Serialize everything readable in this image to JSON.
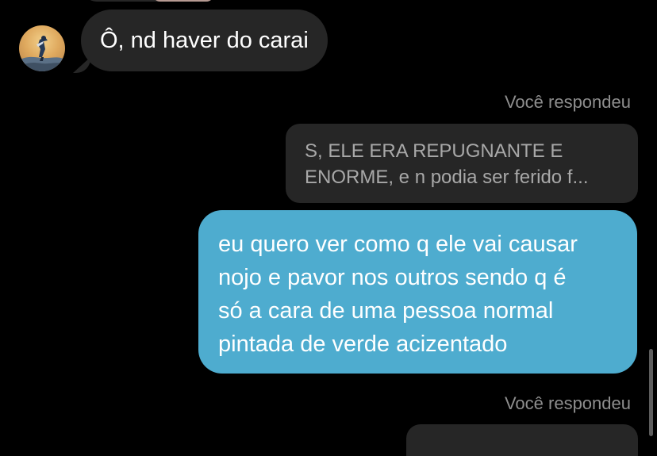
{
  "conversation": {
    "incoming": {
      "text": "Ô, nd haver do carai",
      "avatar_icon": "user-avatar-icon"
    },
    "reply_labels": [
      "Você respondeu",
      "Você respondeu"
    ],
    "quoted": {
      "lines": [
        "S, ELE ERA REPUGNANTE E",
        "ENORME, e n podia ser ferido f..."
      ]
    },
    "outgoing": {
      "lines": [
        "eu quero ver como q ele vai causar",
        "nojo e pavor nos outros sendo q é",
        "só a cara de uma pessoa normal",
        "pintada de verde acizentado"
      ]
    }
  },
  "colors": {
    "background": "#000000",
    "incoming_bubble": "#262626",
    "outgoing_bubble": "#4eaccf",
    "muted_text": "#8e8e8e"
  }
}
